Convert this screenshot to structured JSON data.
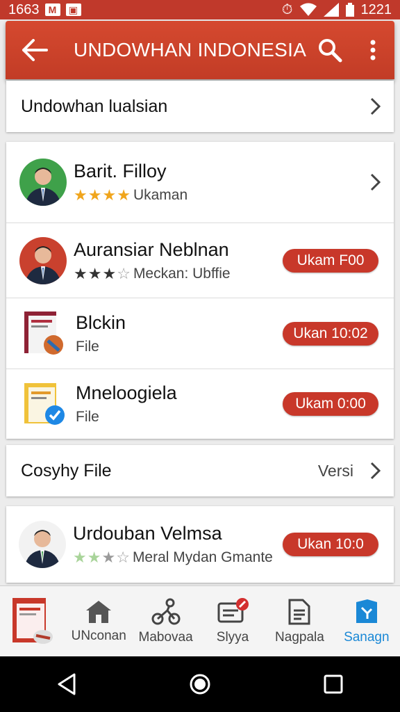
{
  "status_bar": {
    "left_time": "1663",
    "right_time": "1221"
  },
  "app_bar": {
    "title": "UNDOWHAN INDONESIA",
    "back_icon": "arrow-left-icon",
    "search_icon": "search-icon",
    "menu_icon": "more-vert-icon"
  },
  "section_header": {
    "label": "Undowhan lualsian"
  },
  "list_items": [
    {
      "title": "Barit. Filloy",
      "subtitle": "Ukaman",
      "rating": 4.5,
      "star_color": "#f0a51c",
      "pill": ""
    },
    {
      "title": "Auransiar Neblnan",
      "subtitle": "Meckan: Ubffie",
      "rating": 3.5,
      "star_color": "#333333",
      "pill": "Ukam F00"
    },
    {
      "title": "Blckin",
      "subtitle": "File",
      "pill": "Ukan 10:02"
    },
    {
      "title": "Mneloogiela",
      "subtitle": "File",
      "pill": "Ukam 0:00"
    }
  ],
  "file_row": {
    "label": "Cosyhy File",
    "value": "Versi"
  },
  "bottom_item": {
    "title": "Urdouban Velmsa",
    "subtitle": "Meral Mydan Gmante",
    "rating": 3.5,
    "star_color": "#a9d49a",
    "pill": "Ukan 10:0"
  },
  "bottom_nav": [
    {
      "label": "UNconan",
      "icon": "home-icon"
    },
    {
      "label": "Mabovaa",
      "icon": "share-icon"
    },
    {
      "label": "Slyya",
      "icon": "message-icon"
    },
    {
      "label": "Nagpala",
      "icon": "document-icon"
    },
    {
      "label": "Sanagn",
      "icon": "bookmark-icon",
      "active": true
    }
  ],
  "colors": {
    "primary": "#c8382a",
    "accent": "#1a88d6"
  }
}
